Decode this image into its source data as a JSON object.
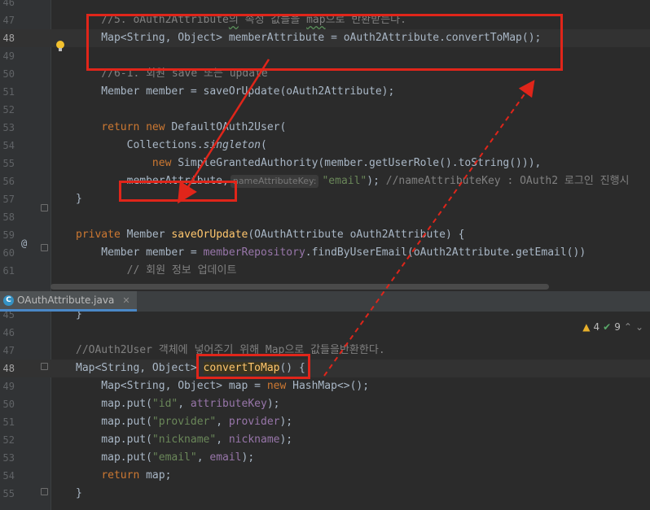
{
  "top_pane": {
    "lines": [
      {
        "num": "46",
        "html": ""
      },
      {
        "num": "47",
        "html": "    <span class=\"cm\">//5. oAuth2Attribute<span class=\"wavy\">의</span> 속성 값들을 <span class=\"wavy\">map</span>으로 반환받는다.</span>"
      },
      {
        "num": "48",
        "html": "    Map&lt;String, Object&gt; memberAttribute = oAuth2Attribute.convertToMap();",
        "current": true
      },
      {
        "num": "49",
        "html": ""
      },
      {
        "num": "50",
        "html": "    <span class=\"cm\">//6-1. 회원 save 또는 update</span>"
      },
      {
        "num": "51",
        "html": "    Member member = saveOrUpdate(oAuth2Attribute);"
      },
      {
        "num": "52",
        "html": ""
      },
      {
        "num": "53",
        "html": "    <span class=\"kw\">return new</span> DefaultOAuth2User("
      },
      {
        "num": "54",
        "html": "        Collections.<span class=\"it\">singleton</span>("
      },
      {
        "num": "55",
        "html": "            <span class=\"kw\">new</span> SimpleGrantedAuthority(member.getUserRole().toString())),"
      },
      {
        "num": "56",
        "html": "        memberAttribute,<span class=\"hint\">nameAttributeKey:</span><span class=\"st\">\"email\"</span>); <span class=\"cm\">//nameAttributeKey : OAuth2 로그인 진행시</span>"
      },
      {
        "num": "57",
        "html": "}"
      },
      {
        "num": "58",
        "html": ""
      },
      {
        "num": "59",
        "html": "<span class=\"kw\">private</span> Member <span class=\"mth\">saveOrUpdate</span>(OAuthAttribute oAuth2Attribute) {"
      },
      {
        "num": "60",
        "html": "    Member member = <span class=\"fld\">memberRepository</span>.findByUserEmail(oAuth2Attribute.getEmail())"
      },
      {
        "num": "61",
        "html": "        <span class=\"cm\">// 회원 정보 업데이트</span>"
      }
    ]
  },
  "tab": {
    "label": "OAuthAttribute.java",
    "icon": "java-class-icon"
  },
  "inspections": {
    "warnings": "4",
    "weak_warnings": "9"
  },
  "bottom_pane": {
    "lines": [
      {
        "num": "45",
        "html": "}"
      },
      {
        "num": "46",
        "html": ""
      },
      {
        "num": "47",
        "html": "<span class=\"cm\">//OAuth2User 객체에 넣어주기 위해 Map으로 값들을반환한다.</span>"
      },
      {
        "num": "48",
        "html": "Map&lt;String, Object&gt; <span class=\"mth match-hl\">convertToMap</span>() {",
        "current": true
      },
      {
        "num": "49",
        "html": "    Map&lt;String, Object&gt; map = <span class=\"kw\">new</span> HashMap&lt;&gt;();"
      },
      {
        "num": "50",
        "html": "    map.put(<span class=\"st\">\"id\"</span>, <span class=\"fld\">attributeKey</span>);"
      },
      {
        "num": "51",
        "html": "    map.put(<span class=\"st\">\"provider\"</span>, <span class=\"fld\">provider</span>);"
      },
      {
        "num": "52",
        "html": "    map.put(<span class=\"st\">\"nickname\"</span>, <span class=\"fld\">nickname</span>);"
      },
      {
        "num": "53",
        "html": "    map.put(<span class=\"st\">\"email\"</span>, <span class=\"fld\">email</span>);"
      },
      {
        "num": "54",
        "html": "    <span class=\"kw\">return</span> map;"
      },
      {
        "num": "55",
        "html": "}"
      }
    ]
  },
  "gutter": {
    "override_marker": "@"
  },
  "colors": {
    "highlight_box": "#e0251a",
    "arrow": "#e0251a"
  }
}
